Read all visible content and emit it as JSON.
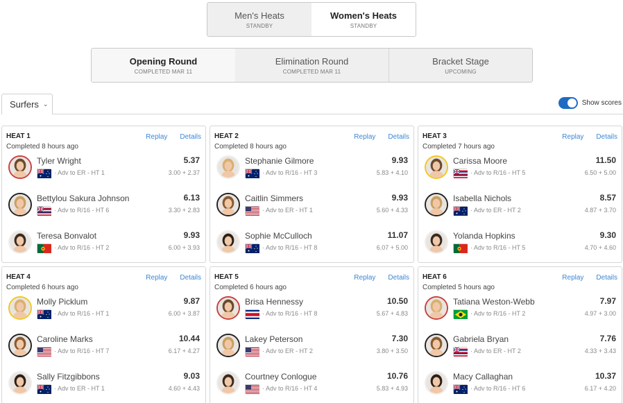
{
  "gender_tabs": [
    {
      "label": "Men's Heats",
      "sub": "STANDBY"
    },
    {
      "label": "Women's Heats",
      "sub": "STANDBY"
    }
  ],
  "round_tabs": [
    {
      "label": "Opening Round",
      "sub": "COMPLETED MAR 11"
    },
    {
      "label": "Elimination Round",
      "sub": "COMPLETED MAR 11"
    },
    {
      "label": "Bracket Stage",
      "sub": "UPCOMING"
    }
  ],
  "filter": {
    "surfers_label": "Surfers",
    "show_scores_label": "Show scores"
  },
  "links": {
    "replay": "Replay",
    "details": "Details"
  },
  "heats": [
    {
      "title": "HEAT 1",
      "status": "Completed 8 hours ago",
      "surfers": [
        {
          "name": "Tyler Wright",
          "country": "AU",
          "adv": "· Adv to ER - HT 1",
          "total": "5.37",
          "waves": "3.00 + 2.37"
        },
        {
          "name": "Bettylou Sakura Johnson",
          "country": "HI",
          "adv": "· Adv to R/16 - HT 6",
          "total": "6.13",
          "waves": "3.30 + 2.83"
        },
        {
          "name": "Teresa Bonvalot",
          "country": "PT",
          "adv": "· Adv to R/16 - HT 2",
          "total": "9.93",
          "waves": "6.00 + 3.93"
        }
      ]
    },
    {
      "title": "HEAT 2",
      "status": "Completed 8 hours ago",
      "surfers": [
        {
          "name": "Stephanie Gilmore",
          "country": "AU",
          "adv": "· Adv to R/16 - HT 3",
          "total": "9.93",
          "waves": "5.83 + 4.10"
        },
        {
          "name": "Caitlin Simmers",
          "country": "US",
          "adv": "· Adv to ER - HT 1",
          "total": "9.93",
          "waves": "5.60 + 4.33"
        },
        {
          "name": "Sophie McCulloch",
          "country": "AU",
          "adv": "· Adv to R/16 - HT 8",
          "total": "11.07",
          "waves": "6.07 + 5.00"
        }
      ]
    },
    {
      "title": "HEAT 3",
      "status": "Completed 7 hours ago",
      "surfers": [
        {
          "name": "Carissa Moore",
          "country": "HI",
          "adv": "· Adv to R/16 - HT 5",
          "total": "11.50",
          "waves": "6.50 + 5.00"
        },
        {
          "name": "Isabella Nichols",
          "country": "AU",
          "adv": "· Adv to ER - HT 2",
          "total": "8.57",
          "waves": "4.87 + 3.70"
        },
        {
          "name": "Yolanda Hopkins",
          "country": "PT",
          "adv": "· Adv to R/16 - HT 5",
          "total": "9.30",
          "waves": "4.70 + 4.60"
        }
      ]
    },
    {
      "title": "HEAT 4",
      "status": "Completed 6 hours ago",
      "surfers": [
        {
          "name": "Molly Picklum",
          "country": "AU",
          "adv": "· Adv to R/16 - HT 1",
          "total": "9.87",
          "waves": "6.00 + 3.87"
        },
        {
          "name": "Caroline Marks",
          "country": "US",
          "adv": "· Adv to R/16 - HT 7",
          "total": "10.44",
          "waves": "6.17 + 4.27"
        },
        {
          "name": "Sally Fitzgibbons",
          "country": "AU",
          "adv": "· Adv to ER - HT 1",
          "total": "9.03",
          "waves": "4.60 + 4.43"
        }
      ]
    },
    {
      "title": "HEAT 5",
      "status": "Completed 6 hours ago",
      "surfers": [
        {
          "name": "Brisa Hennessy",
          "country": "CR",
          "adv": "· Adv to R/16 - HT 8",
          "total": "10.50",
          "waves": "5.67 + 4.83"
        },
        {
          "name": "Lakey Peterson",
          "country": "US",
          "adv": "· Adv to ER - HT 2",
          "total": "7.30",
          "waves": "3.80 + 3.50"
        },
        {
          "name": "Courtney Conlogue",
          "country": "US",
          "adv": "· Adv to R/16 - HT 4",
          "total": "10.76",
          "waves": "5.83 + 4.93"
        }
      ]
    },
    {
      "title": "HEAT 6",
      "status": "Completed 5 hours ago",
      "surfers": [
        {
          "name": "Tatiana Weston-Webb",
          "country": "BR",
          "adv": "· Adv to R/16 - HT 2",
          "total": "7.97",
          "waves": "4.97 + 3.00"
        },
        {
          "name": "Gabriela Bryan",
          "country": "HI",
          "adv": "· Adv to ER - HT 2",
          "total": "7.76",
          "waves": "4.33 + 3.43"
        },
        {
          "name": "Macy Callaghan",
          "country": "AU",
          "adv": "· Adv to R/16 - HT 6",
          "total": "10.37",
          "waves": "6.17 + 4.20"
        }
      ]
    }
  ]
}
